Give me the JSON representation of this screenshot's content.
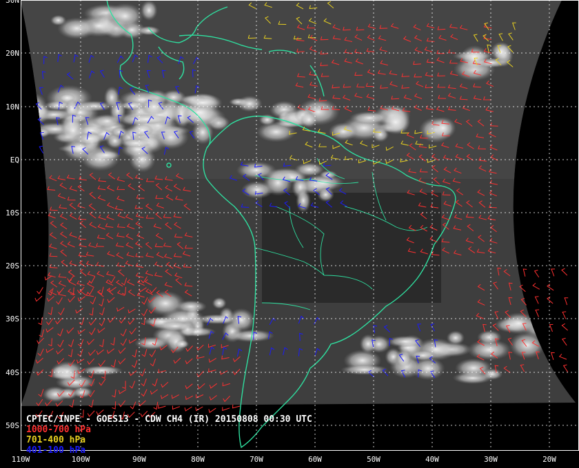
{
  "map": {
    "product_title": "CPTEC/INPE - GOES13 - CDW CH4 (IR) 20150808 00:30 UTC",
    "legend": [
      {
        "label": "1000-700 hPa",
        "color": "#ff3030"
      },
      {
        "label": "701-400 hPa",
        "color": "#e8d020"
      },
      {
        "label": "401-100 hPa",
        "color": "#1a1aff"
      }
    ],
    "latitude_labels": [
      "30N",
      "20N",
      "10N",
      "EQ",
      "10S",
      "20S",
      "30S",
      "40S",
      "50S"
    ],
    "longitude_labels": [
      "110W",
      "100W",
      "90W",
      "80W",
      "70W",
      "60W",
      "50W",
      "40W",
      "30W",
      "20W"
    ],
    "colors": {
      "coastline": "#2fe0a0",
      "grid": "#ffffff",
      "background": "#000000"
    }
  }
}
